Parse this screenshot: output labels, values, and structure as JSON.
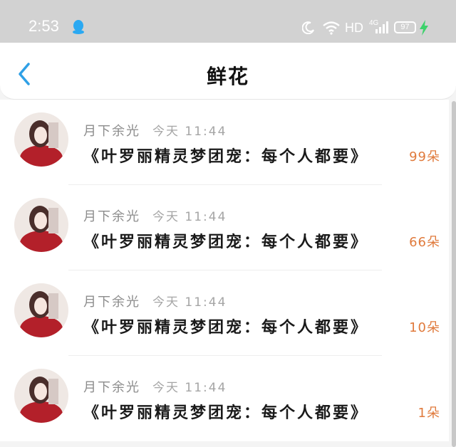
{
  "status_bar": {
    "time": "2:53",
    "network_label": "HD",
    "network_type": "4G",
    "battery": "97",
    "icons": [
      "qq-icon",
      "moon-icon",
      "wifi-icon",
      "signal-icon",
      "charge-icon"
    ],
    "colors": {
      "background": "#d2d2d2",
      "qq": "#2ba9f2",
      "charge": "#3dd26b"
    }
  },
  "header": {
    "title": "鲜花",
    "back_icon": "chevron-left-icon",
    "accent": "#2fa0e6"
  },
  "items": [
    {
      "sender": "月下余光",
      "time": "今天 11:44",
      "title": "《叶罗丽精灵梦团宠：每个人都要》",
      "count": "99朵"
    },
    {
      "sender": "月下余光",
      "time": "今天 11:44",
      "title": "《叶罗丽精灵梦团宠：每个人都要》",
      "count": "66朵"
    },
    {
      "sender": "月下余光",
      "time": "今天 11:44",
      "title": "《叶罗丽精灵梦团宠：每个人都要》",
      "count": "10朵"
    },
    {
      "sender": "月下余光",
      "time": "今天 11:44",
      "title": "《叶罗丽精灵梦团宠：每个人都要》",
      "count": "1朵"
    }
  ],
  "count_color": "#e07a3c"
}
